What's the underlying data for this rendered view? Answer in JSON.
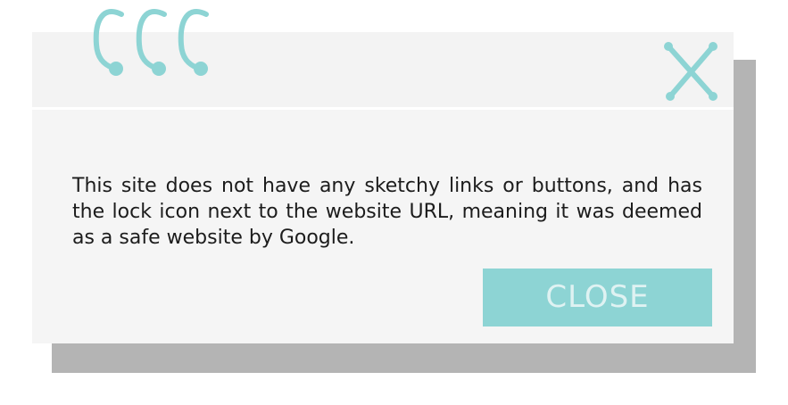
{
  "dialog": {
    "message": "This site does not have any sketchy links or buttons, and has the lock icon next to the website URL, meaning it was deemed as a safe website by Google.",
    "close_button_label": "CLOSE",
    "icons": {
      "binder_rings": "binder-rings-icon",
      "close": "close-x-icon"
    }
  },
  "colors": {
    "accent": "#8dd4d4",
    "button_text": "#dff2f2",
    "panel": "#f5f5f5",
    "shadow": "#b4b4b4",
    "text": "#1c1c1c"
  }
}
